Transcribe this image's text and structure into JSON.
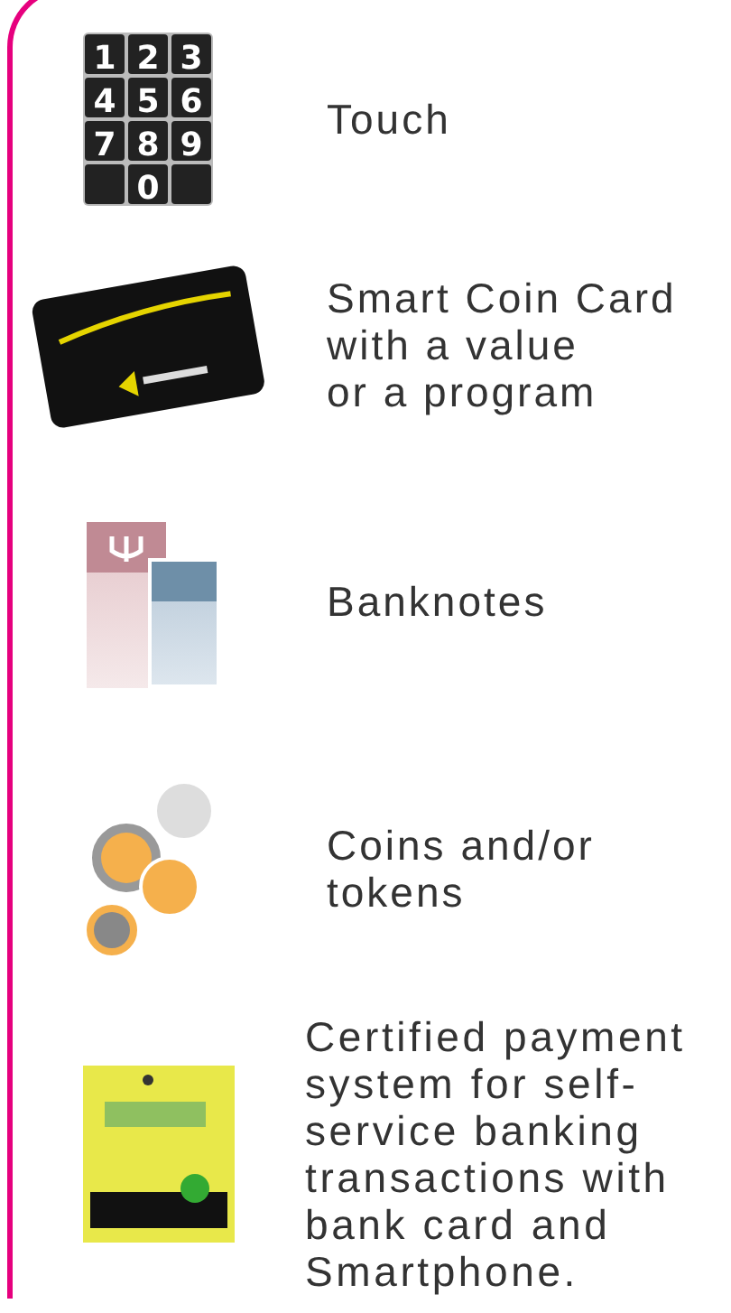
{
  "payment_methods": [
    {
      "kind": "keypad",
      "keys": [
        "1",
        "2",
        "3",
        "4",
        "5",
        "6",
        "7",
        "8",
        "9",
        "0"
      ],
      "label": "Touch"
    },
    {
      "kind": "card",
      "label": "Smart Coin Card\nwith a value\nor a program"
    },
    {
      "kind": "banknotes",
      "label": "Banknotes"
    },
    {
      "kind": "coins",
      "label": "Coins and/or\ntokens"
    },
    {
      "kind": "terminal",
      "label": "Certified payment\nsystem for self-\nservice banking\ntransactions with\nbank card and\nSmartphone."
    }
  ]
}
